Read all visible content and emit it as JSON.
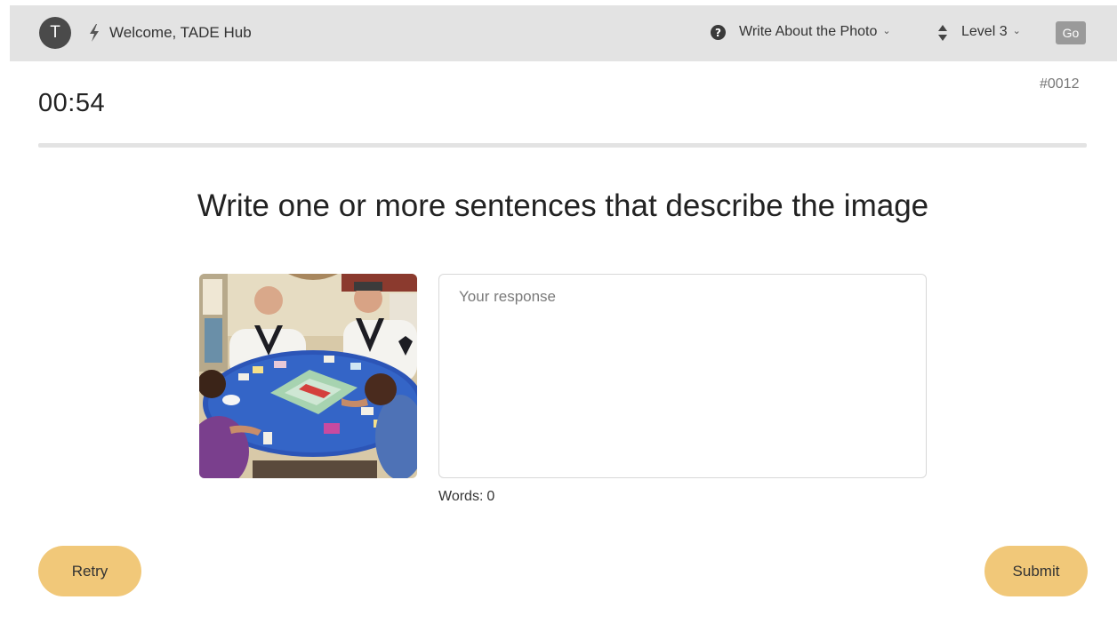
{
  "header": {
    "avatar_initial": "T",
    "welcome_text": "Welcome, TADE Hub",
    "task_select": {
      "value": "Write About the Photo"
    },
    "level_select": {
      "value": "Level 3"
    },
    "go_label": "Go",
    "icons": {
      "bolt": "lightning-bolt-icon",
      "help": "question-circle-icon",
      "sort": "sort-arrows-icon",
      "chevron": "chevron-down-icon"
    }
  },
  "task": {
    "timer": "00:54",
    "item_id": "#0012",
    "progress": 0,
    "prompt": "Write one or more sentences that describe the image"
  },
  "response": {
    "placeholder": "Your response",
    "value": "",
    "word_count_label": "Words:",
    "word_count": "0"
  },
  "actions": {
    "retry_label": "Retry",
    "submit_label": "Submit"
  },
  "colors": {
    "topbar": "#e3e3e3",
    "avatar": "#4a4a4a",
    "go_button": "#9a9a9a",
    "action_buttons": "#f1c879",
    "progress_track": "#e3e3e3"
  }
}
